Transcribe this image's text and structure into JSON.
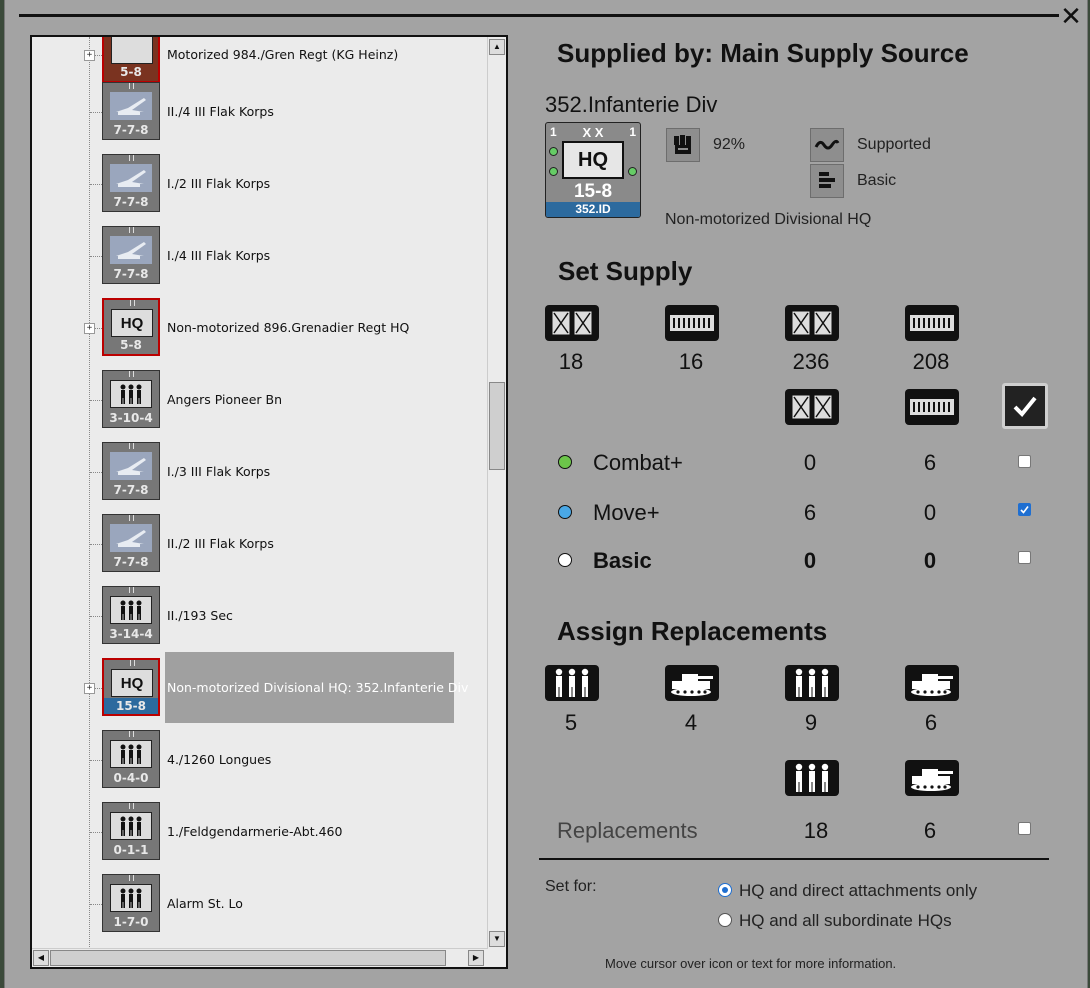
{
  "tree": {
    "nodes": [
      {
        "label": "Motorized 984./Gren Regt (KG Heinz)",
        "value": "5-8",
        "kind": "brown",
        "expandable": true
      },
      {
        "label": "II./4 III Flak Korps",
        "value": "7-7-8",
        "kind": "flak"
      },
      {
        "label": "I./2 III Flak Korps",
        "value": "7-7-8",
        "kind": "flak"
      },
      {
        "label": "I./4 III Flak Korps",
        "value": "7-7-8",
        "kind": "flak"
      },
      {
        "label": "Non-motorized 896.Grenadier Regt HQ",
        "value": "5-8",
        "kind": "hq",
        "pic": "HQ",
        "expandable": true
      },
      {
        "label": "Angers Pioneer Bn",
        "value": "3-10-4",
        "kind": "unit"
      },
      {
        "label": "I./3 III Flak Korps",
        "value": "7-7-8",
        "kind": "flak"
      },
      {
        "label": "II./2 III Flak Korps",
        "value": "7-7-8",
        "kind": "flak"
      },
      {
        "label": "II./193 Sec",
        "value": "3-14-4",
        "kind": "unit"
      },
      {
        "label": "Non-motorized Divisional HQ: 352.Infanterie Div",
        "value": "15-8",
        "kind": "hq352",
        "pic": "HQ",
        "expandable": true,
        "selected": true
      },
      {
        "label": "4./1260 Longues",
        "value": "0-4-0",
        "kind": "unit"
      },
      {
        "label": "1./Feldgendarmerie-Abt.460",
        "value": "0-1-1",
        "kind": "unit"
      },
      {
        "label": "Alarm St. Lo",
        "value": "1-7-0",
        "kind": "unit"
      }
    ]
  },
  "supply": {
    "title": "Supplied by: Main Supply Source",
    "unit_name": "352.Infanterie Div",
    "counter": {
      "echelon": "X X",
      "corner_left": "1",
      "corner_right": "1",
      "pic": "HQ",
      "value": "15-8",
      "id": "352.ID"
    },
    "percent": "92%",
    "supported": "Supported",
    "basic": "Basic",
    "unit_type": "Non-motorized Divisional HQ"
  },
  "set_supply": {
    "title": "Set Supply",
    "top_values": [
      "18",
      "16",
      "236",
      "208"
    ],
    "rows": [
      {
        "label": "Combat+",
        "color": "#6cc54a",
        "a": "0",
        "b": "6",
        "checked": false
      },
      {
        "label": "Move+",
        "color": "#4aa8e6",
        "a": "6",
        "b": "0",
        "checked": true
      },
      {
        "label": "Basic",
        "color": "#ffffff",
        "a": "0",
        "b": "0",
        "checked": false
      }
    ]
  },
  "replacements": {
    "title": "Assign Replacements",
    "top_values": [
      "5",
      "4",
      "9",
      "6"
    ],
    "label": "Replacements",
    "a": "18",
    "b": "6"
  },
  "set_for": {
    "label": "Set for:",
    "option1": "HQ and direct attachments only",
    "option2": "HQ and all subordinate HQs"
  },
  "hint": "Move cursor over icon or text for more information."
}
